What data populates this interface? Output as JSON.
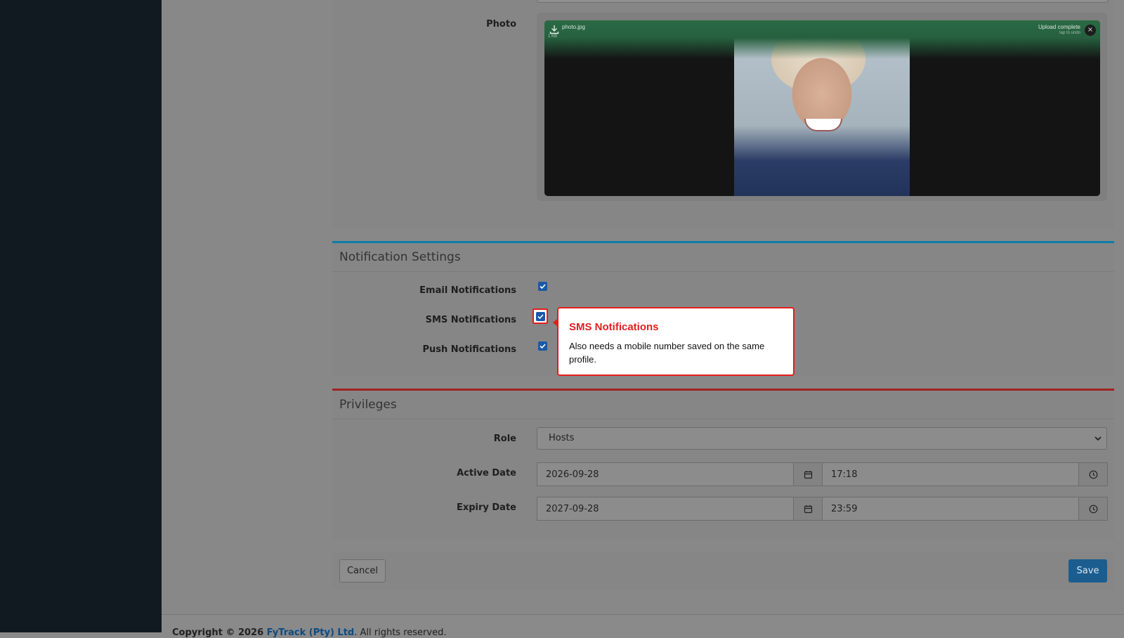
{
  "photo_section": {
    "label": "Photo",
    "file_name": "photo.jpg",
    "file_size": "1 KB",
    "upload_status": "Upload complete",
    "upload_hint": "tap to undo",
    "close_glyph": "×"
  },
  "notification_settings": {
    "title": "Notification Settings",
    "email_label": "Email Notifications",
    "sms_label": "SMS Notifications",
    "push_label": "Push Notifications",
    "email_checked": true,
    "sms_checked": true,
    "push_checked": true
  },
  "popover": {
    "title": "SMS Notifications",
    "body": "Also needs a mobile number saved on the same profile."
  },
  "privileges": {
    "title": "Privileges",
    "role_label": "Role",
    "role_value": "Hosts",
    "active_label": "Active Date",
    "active_date": "2026-09-28",
    "active_time": "17:18",
    "expiry_label": "Expiry Date",
    "expiry_date": "2027-09-28",
    "expiry_time": "23:59"
  },
  "actions": {
    "cancel_label": "Cancel",
    "save_label": "Save"
  },
  "footer": {
    "prefix": "Copyright © 2026 ",
    "company": "FyTrack (Pty) Ltd",
    "suffix": ". All rights reserved."
  },
  "icons": {
    "download": "download-icon",
    "calendar": "calendar-icon",
    "clock": "clock-icon",
    "chevron": "chevron-down-icon",
    "check": "check-icon"
  },
  "colors": {
    "notification_accent": "#0e7ba8",
    "privileges_accent": "#9e2321",
    "highlight": "#e61d1d",
    "save_button": "#1b5d8f"
  }
}
